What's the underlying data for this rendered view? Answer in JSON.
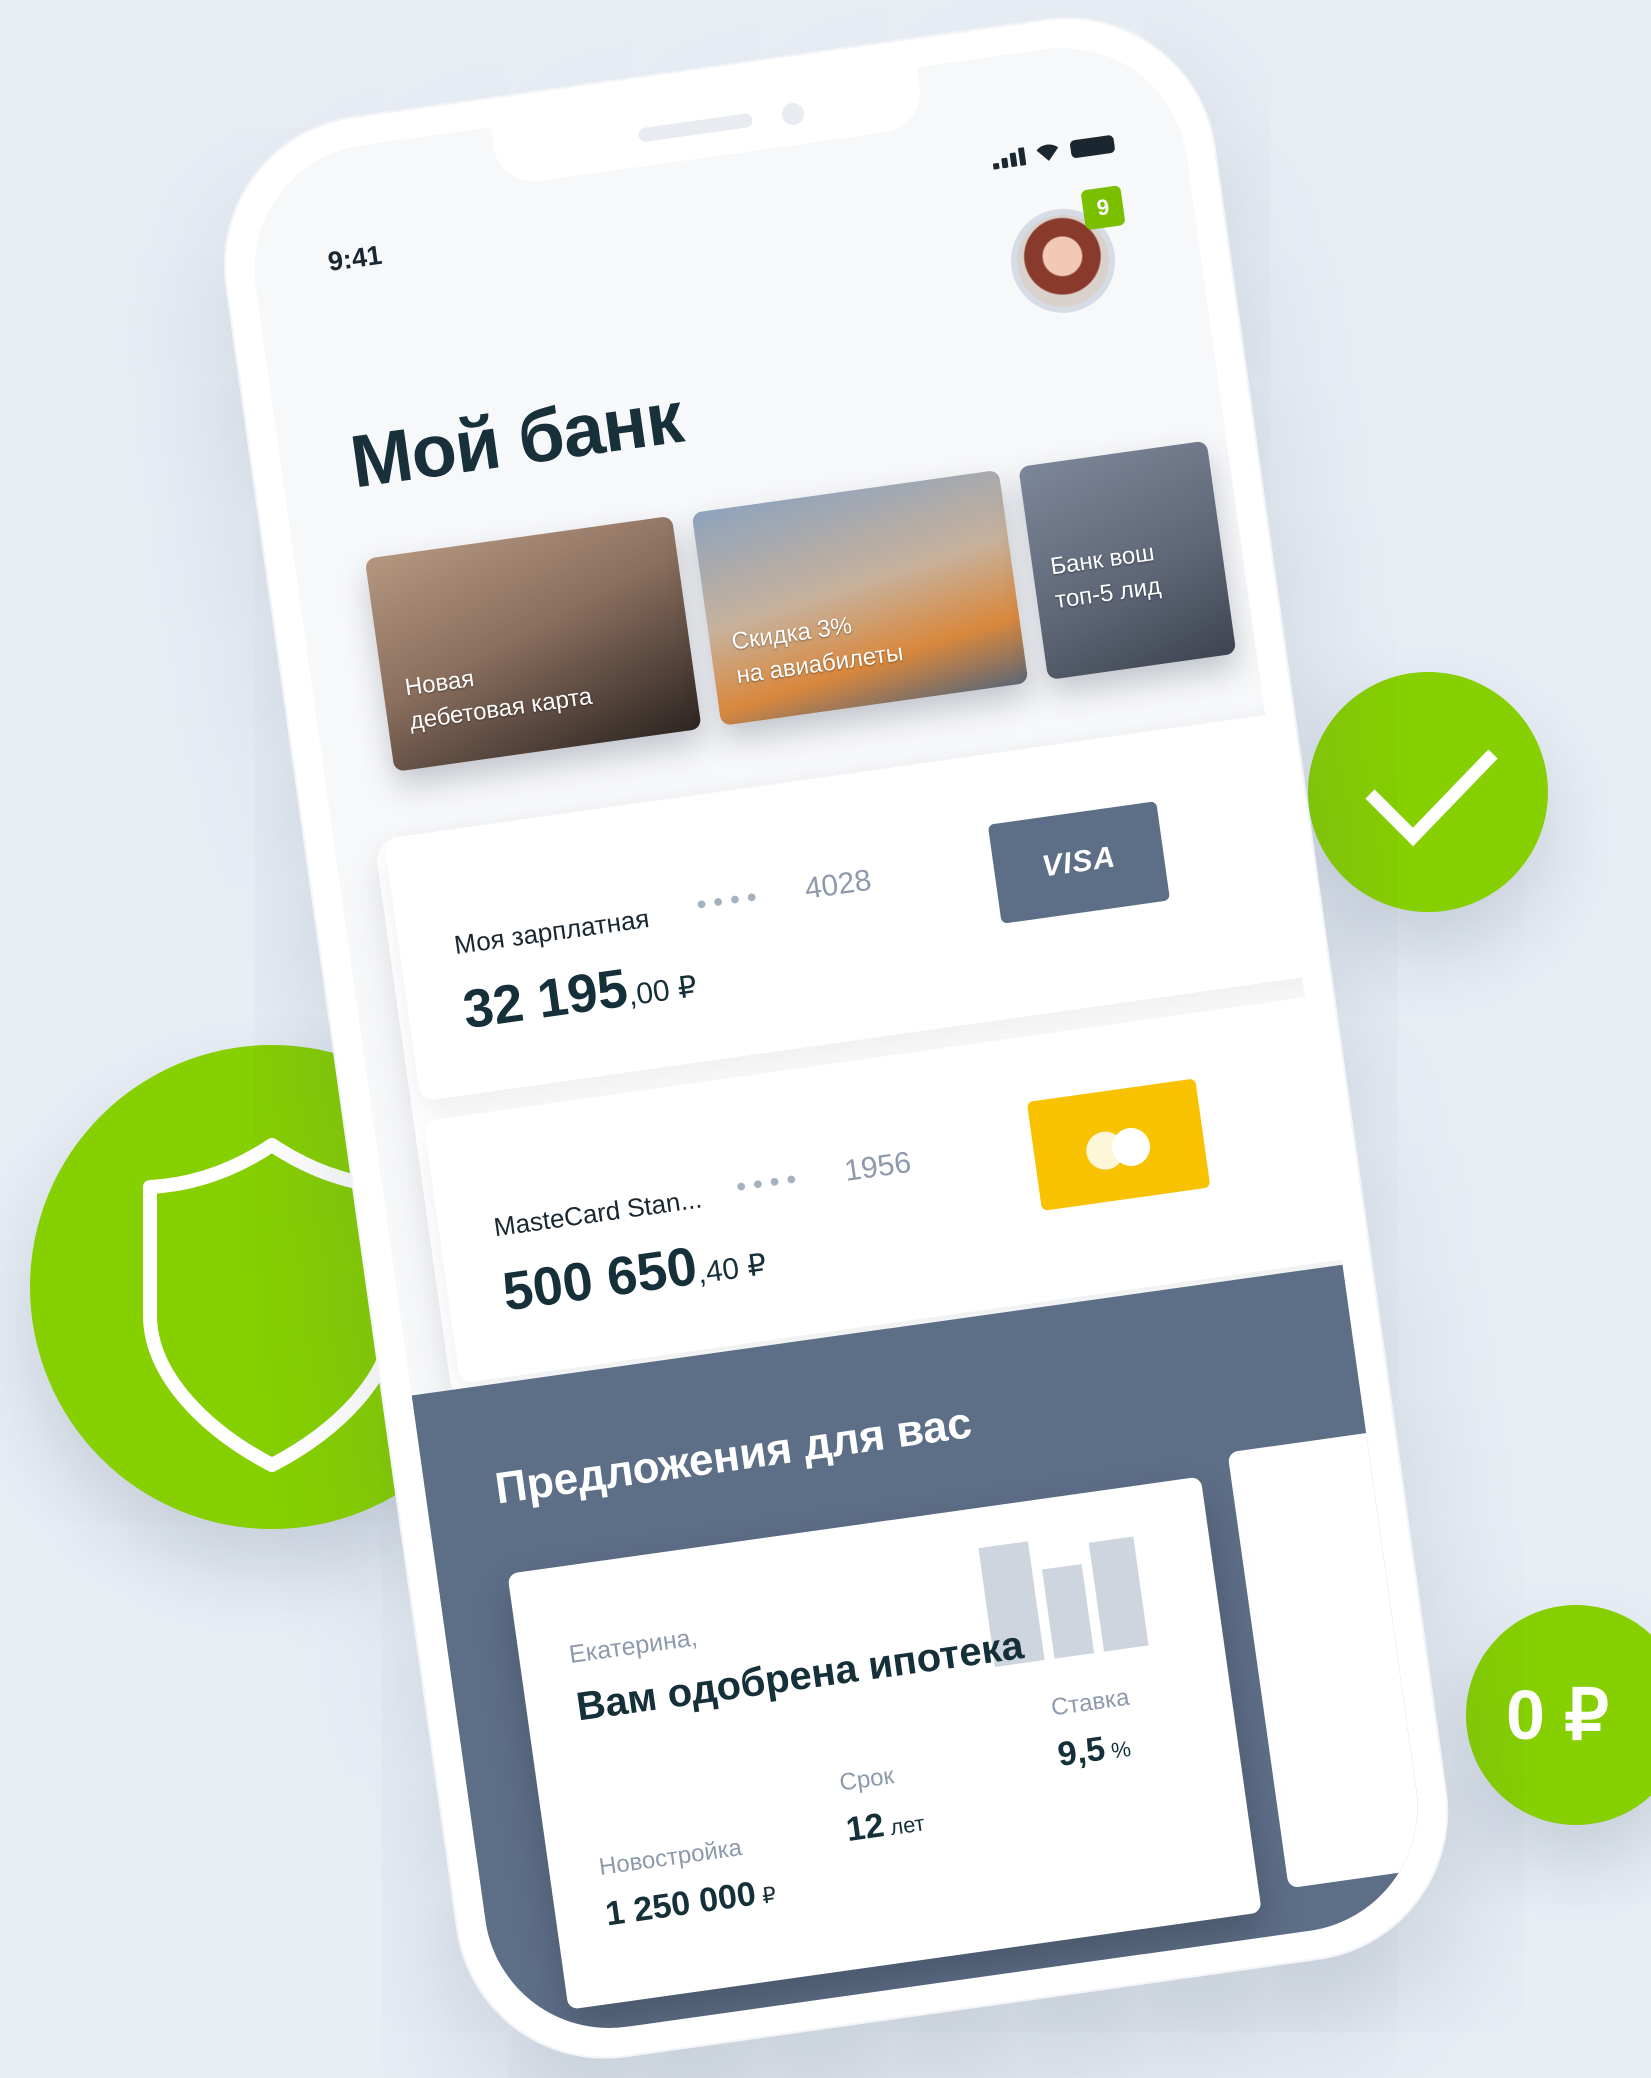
{
  "badges": {
    "ruble": "0 ₽"
  },
  "status": {
    "time": "9:41"
  },
  "header": {
    "title": "Мой банк",
    "notifications": "9"
  },
  "stories": [
    {
      "label": "Новая\nдебетовая карта"
    },
    {
      "label": "Скидка 3%\nна авиабилеты"
    },
    {
      "label": "Банк вош\nтоп-5 лид"
    }
  ],
  "accounts": [
    {
      "name": "Моя зарплатная",
      "dots": "●●●●",
      "last4": "4028",
      "amount_int": "32 195",
      "amount_frac": ",00 ₽",
      "brand": "VISA"
    },
    {
      "name": "MasteCard Stan...",
      "dots": "●●●●",
      "last4": "1956",
      "amount_int": "500 650",
      "amount_frac": ",40 ₽",
      "brand": "mastercard"
    }
  ],
  "offers": {
    "title": "Предложения для вас",
    "card": {
      "greeting": "Екатерина,",
      "headline": "Вам одобрена ипотека",
      "stats": [
        {
          "label": "Новостройка",
          "value": "1 250 000",
          "unit": " ₽"
        },
        {
          "label": "Срок",
          "value": "12",
          "unit": " лет"
        },
        {
          "label": "Ставка",
          "value": "9,5",
          "unit": " %"
        }
      ]
    }
  },
  "colors": {
    "accent_green": "#86cf00",
    "slate": "#5d6e87",
    "mastercard_yellow": "#f9c200",
    "background": "#e9eef5"
  },
  "icons": {
    "check_badge": "check-icon",
    "shield_badge": "shield-icon",
    "wifi": "wifi-icon",
    "battery": "battery-icon",
    "signal": "signal-icon"
  }
}
